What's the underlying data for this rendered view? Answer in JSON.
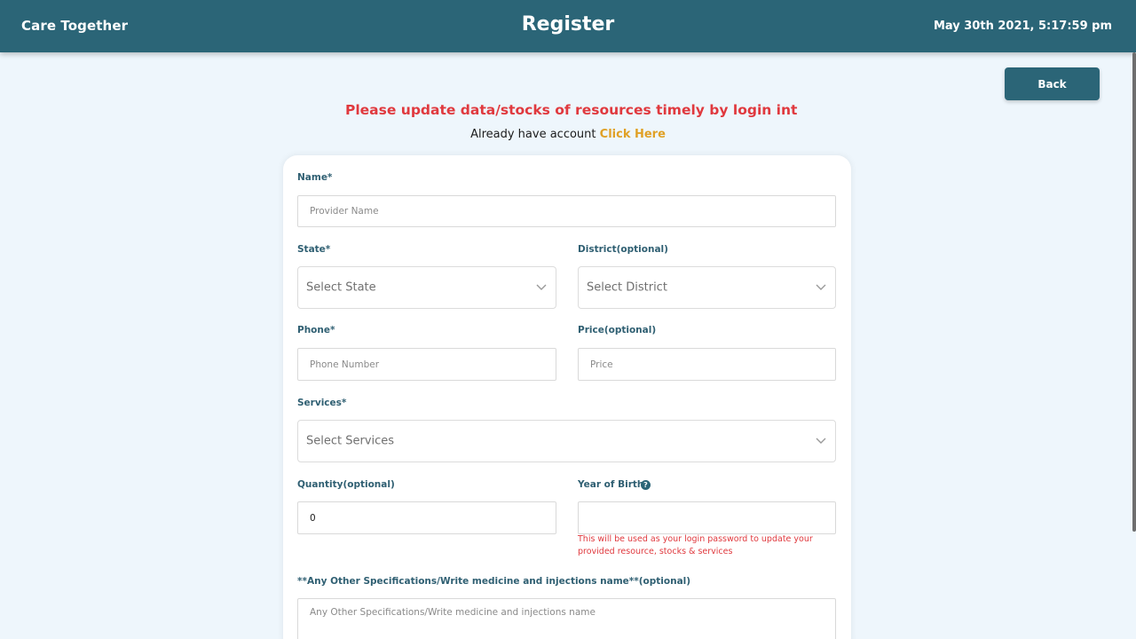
{
  "header": {
    "brand": "Care Together",
    "title": "Register",
    "datetime": "May 30th 2021, 5:17:59 pm"
  },
  "back_button": "Back",
  "notice": "Please update data/stocks of resources timely by login into yo",
  "account": {
    "text": "Already have account",
    "link": "Click Here"
  },
  "form": {
    "name": {
      "label": "Name*",
      "placeholder": "Provider Name"
    },
    "state": {
      "label": "State*",
      "value": "Select State"
    },
    "district": {
      "label": "District(optional)",
      "value": "Select District"
    },
    "phone": {
      "label": "Phone*",
      "placeholder": "Phone Number"
    },
    "price": {
      "label": "Price(optional)",
      "placeholder": "Price"
    },
    "services": {
      "label": "Services*",
      "value": "Select Services"
    },
    "quantity": {
      "label": "Quantity(optional)",
      "value": "0"
    },
    "year_of_birth": {
      "label": "Year of Birth*",
      "icon": "question-circle-icon",
      "hint": "This will be used as your login password to update your provided resource, stocks & services"
    },
    "other_specs": {
      "label": "**Any Other Specifications/Write medicine and injections name**(optional)",
      "placeholder": "Any Other Specifications/Write medicine and injections name"
    }
  },
  "colors": {
    "header_bg": "#2b6577",
    "page_bg": "#eef6fc",
    "notice": "#e0393e",
    "link": "#e0a126",
    "label": "#2f5f72"
  }
}
